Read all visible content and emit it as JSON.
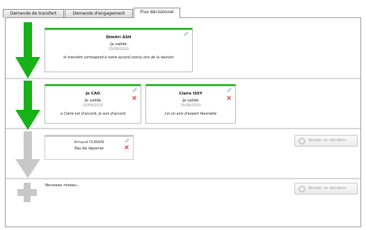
{
  "tabs": [
    {
      "label": "Demande de transfert",
      "active": false
    },
    {
      "label": "Demande d'engagement",
      "active": false
    },
    {
      "label": "Flux décisionnel",
      "active": true
    }
  ],
  "levels": [
    {
      "cards": [
        {
          "name": "Dimitri ASH",
          "decision": "Je valide",
          "date": "15/09/2010",
          "comment": "le transfert correspond à notre accord conclu lors de la réunion",
          "deletable": false
        }
      ]
    },
    {
      "cards": [
        {
          "name": "Jo CAO",
          "decision": "Je valide",
          "date": "15/09/2010",
          "comment": "e Claire est d'accord, je suis d'accord",
          "deletable": true
        },
        {
          "name": "Claire ISSY",
          "decision": "Je valide",
          "date": "15/09/2010",
          "comment": "j'ai un avis d'expert favorable",
          "deletable": true
        }
      ]
    },
    {
      "cards": [
        {
          "name": "Arnaud DUBAIN",
          "decision": "Pas de réponse",
          "date": "",
          "comment": "",
          "deletable": true
        }
      ],
      "add_button": "Ajouter un décideur"
    }
  ],
  "new_level": {
    "label": "Nouveau niveau...",
    "add_button": "Ajouter un décideur"
  },
  "colors": {
    "approved_accent": "#2dbb2d",
    "pending_accent": "#b4b4b4",
    "arrow_done": "#17b217",
    "arrow_pending": "#c8c8c8",
    "delete": "#e24a4a"
  }
}
